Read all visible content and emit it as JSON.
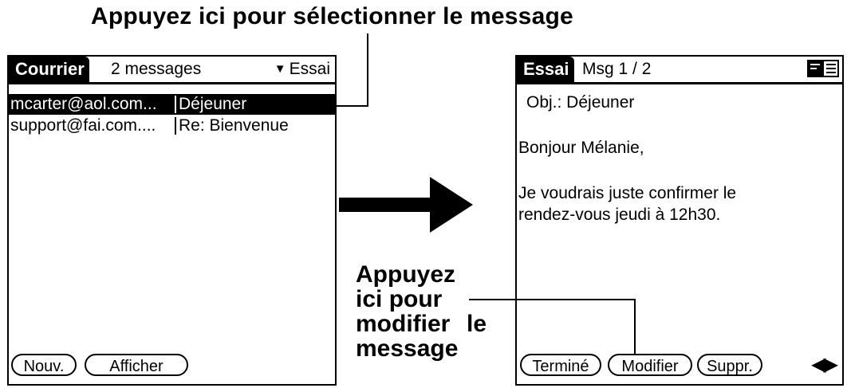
{
  "top_caption": "Appuyez ici pour sélectionner le message",
  "left_screen": {
    "title": "Courrier",
    "count": "2 messages",
    "category": "Essai",
    "messages": [
      {
        "from": "mcarter@aol.com...",
        "subject": "Déjeuner",
        "selected": true
      },
      {
        "from": "support@fai.com....",
        "subject": "Re: Bienvenue",
        "selected": false
      }
    ],
    "buttons": {
      "new": "Nouv.",
      "show": "Afficher"
    }
  },
  "right_screen": {
    "title": "Essai",
    "msg_index": "Msg 1 / 2",
    "subject": "Obj.: Déjeuner",
    "body": [
      "Bonjour Mélanie,",
      "Je voudrais juste confirmer le",
      "rendez-vous jeudi à 12h30."
    ],
    "buttons": {
      "done": "Terminé",
      "edit": "Modifier",
      "delete": "Suppr."
    },
    "nav": "◀▶"
  },
  "callout": {
    "lines": [
      "Appuyez",
      "ici pour",
      "modifier",
      "le",
      "message"
    ]
  }
}
